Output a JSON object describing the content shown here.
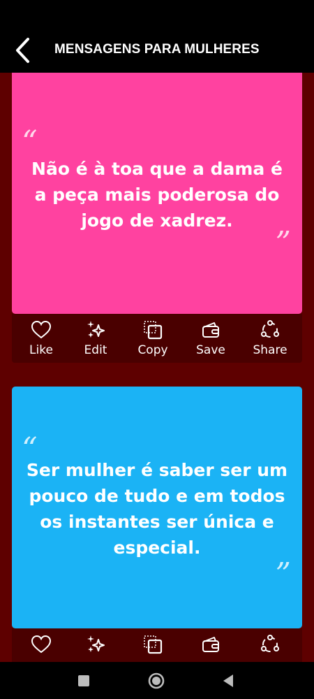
{
  "header": {
    "title": "MENSAGENS PARA MULHERES",
    "back_icon": "back-arrow-icon"
  },
  "colors": {
    "page_background": "#5e0000",
    "card_1": "#ff42a0",
    "card_2": "#1bb3f5",
    "action_bar": "#4a0000"
  },
  "cards": [
    {
      "text": "Não é à toa que a dama é a peça mais poderosa do jogo de xadrez.",
      "open_quote": "“",
      "close_quote": "”",
      "actions": [
        "Like",
        "Edit",
        "Copy",
        "Save",
        "Share"
      ]
    },
    {
      "text": "Ser mulher é saber ser um pouco de tudo e em todos os instantes ser única e especial.",
      "open_quote": "“",
      "close_quote": "”",
      "actions": []
    }
  ],
  "action_icons": [
    "heart-icon",
    "sparkles-icon",
    "copy-icon",
    "wallet-icon",
    "share-icon"
  ],
  "system_nav": [
    "recents-icon",
    "home-icon",
    "back-icon"
  ]
}
